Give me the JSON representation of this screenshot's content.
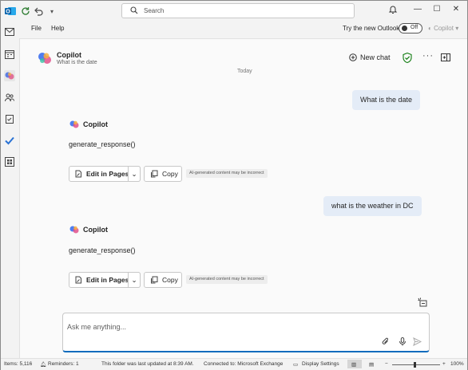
{
  "titlebar": {
    "search_placeholder": "Search"
  },
  "menu": {
    "file": "File",
    "help": "Help",
    "try_outlook": "Try the new Outlook",
    "toggle_state": "Off",
    "copilot_menu": "Copilot"
  },
  "copilot_header": {
    "title": "Copilot",
    "subtitle": "What is the date",
    "new_chat": "New chat"
  },
  "conversation": {
    "day_label": "Today",
    "messages": [
      {
        "role": "user",
        "text": "What is the date"
      },
      {
        "role": "assistant",
        "name": "Copilot",
        "text": "generate_response()",
        "edit_label": "Edit in Pages",
        "copy_label": "Copy",
        "ai_note": "AI-generated content may be incorrect"
      },
      {
        "role": "user",
        "text": "what is the weather in DC"
      },
      {
        "role": "assistant",
        "name": "Copilot",
        "text": "generate_response()",
        "edit_label": "Edit in Pages",
        "copy_label": "Copy",
        "ai_note": "AI-generated content may be incorrect"
      }
    ]
  },
  "composer": {
    "placeholder": "Ask me anything..."
  },
  "statusbar": {
    "items": "Items: 5,116",
    "reminders": "Reminders: 1",
    "updated": "This folder was last updated at 8:39 AM.",
    "connected": "Connected to: Microsoft Exchange",
    "display_settings": "Display Settings",
    "zoom": "100%"
  },
  "colors": {
    "accent": "#0f6cbd",
    "user_bubble": "#e4ecf7",
    "shield_green": "#107c10"
  }
}
